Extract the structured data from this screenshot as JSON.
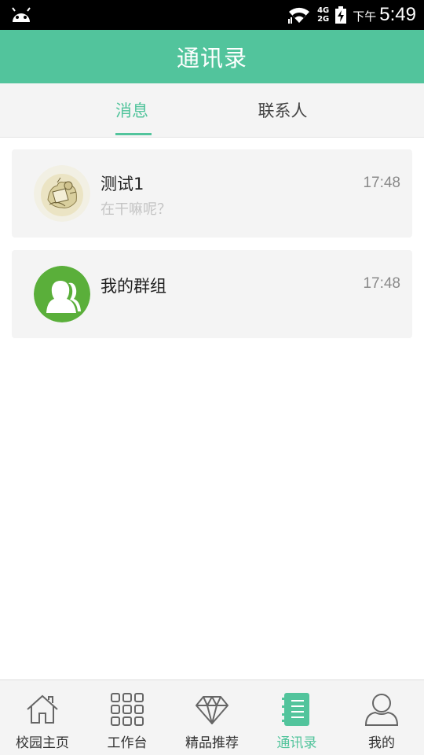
{
  "status_bar": {
    "network_top": "4G",
    "network_bottom": "2G",
    "ampm": "下午",
    "time": "5:49"
  },
  "header": {
    "title": "通讯录"
  },
  "tabs": [
    {
      "label": "消息",
      "active": true
    },
    {
      "label": "联系人",
      "active": false
    }
  ],
  "conversations": [
    {
      "name": "测试1",
      "preview": "在干嘛呢？",
      "time": "17:48",
      "avatar_icon": "sketch-photo-avatar-icon"
    },
    {
      "name": "我的群组",
      "preview": "",
      "time": "17:48",
      "avatar_icon": "group-avatar-icon"
    }
  ],
  "bottom_nav": [
    {
      "label": "校园主页",
      "icon": "home-icon",
      "active": false
    },
    {
      "label": "工作台",
      "icon": "grid-icon",
      "active": false
    },
    {
      "label": "精品推荐",
      "icon": "diamond-icon",
      "active": false
    },
    {
      "label": "通讯录",
      "icon": "contacts-book-icon",
      "active": true
    },
    {
      "label": "我的",
      "icon": "user-icon",
      "active": false
    }
  ],
  "colors": {
    "accent": "#52c49c",
    "group_avatar": "#5aaf3a",
    "status_bar": "#000000",
    "card_background": "#f4f4f4"
  }
}
